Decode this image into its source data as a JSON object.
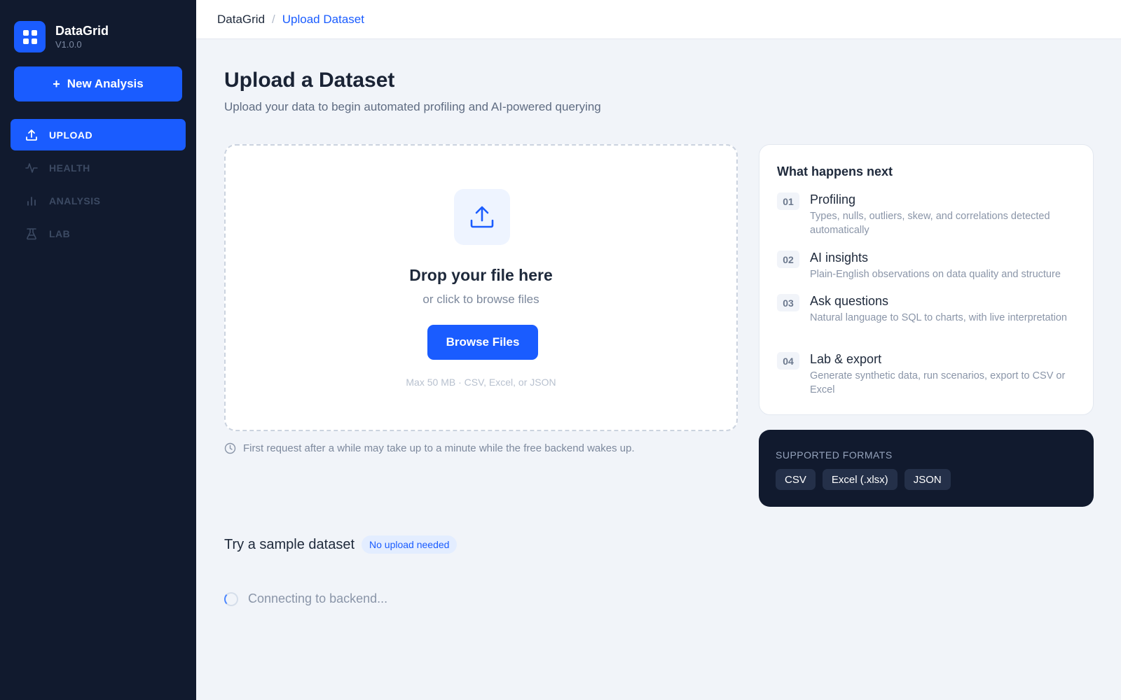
{
  "brand": {
    "name": "DataGrid",
    "version": "V1.0.0"
  },
  "sidebar": {
    "new_button_label": "New Analysis",
    "items": [
      {
        "label": "UPLOAD",
        "icon": "upload-icon",
        "active": true
      },
      {
        "label": "HEALTH",
        "icon": "activity-icon",
        "active": false
      },
      {
        "label": "ANALYSIS",
        "icon": "bar-chart-icon",
        "active": false
      },
      {
        "label": "LAB",
        "icon": "flask-icon",
        "active": false
      }
    ]
  },
  "breadcrumb": {
    "root": "DataGrid",
    "separator": "/",
    "current": "Upload Dataset"
  },
  "page": {
    "title": "Upload a Dataset",
    "subtitle": "Upload your data to begin automated profiling and AI-powered querying"
  },
  "dropzone": {
    "title": "Drop your file here",
    "subtitle": "or click to browse files",
    "button_label": "Browse Files",
    "note": "Max 50 MB · CSV, Excel, or JSON"
  },
  "wake_note": "First request after a while may take up to a minute while the free backend wakes up.",
  "next_steps": {
    "title": "What happens next",
    "steps": [
      {
        "num": "01",
        "title": "Profiling",
        "desc": "Types, nulls, outliers, skew, and correlations detected automatically"
      },
      {
        "num": "02",
        "title": "AI insights",
        "desc": "Plain-English observations on data quality and structure"
      },
      {
        "num": "03",
        "title": "Ask questions",
        "desc": "Natural language to SQL to charts, with live interpretation"
      },
      {
        "num": "04",
        "title": "Lab & export",
        "desc": "Generate synthetic data, run scenarios, export to CSV or Excel"
      }
    ]
  },
  "formats": {
    "title": "SUPPORTED FORMATS",
    "items": [
      "CSV",
      "Excel (.xlsx)",
      "JSON"
    ]
  },
  "sample": {
    "title": "Try a sample dataset",
    "badge": "No upload needed"
  },
  "status": {
    "connecting": "Connecting to backend..."
  },
  "colors": {
    "accent": "#1a5cff",
    "sidebar_bg": "#111a2e",
    "page_bg": "#f1f4f9"
  }
}
